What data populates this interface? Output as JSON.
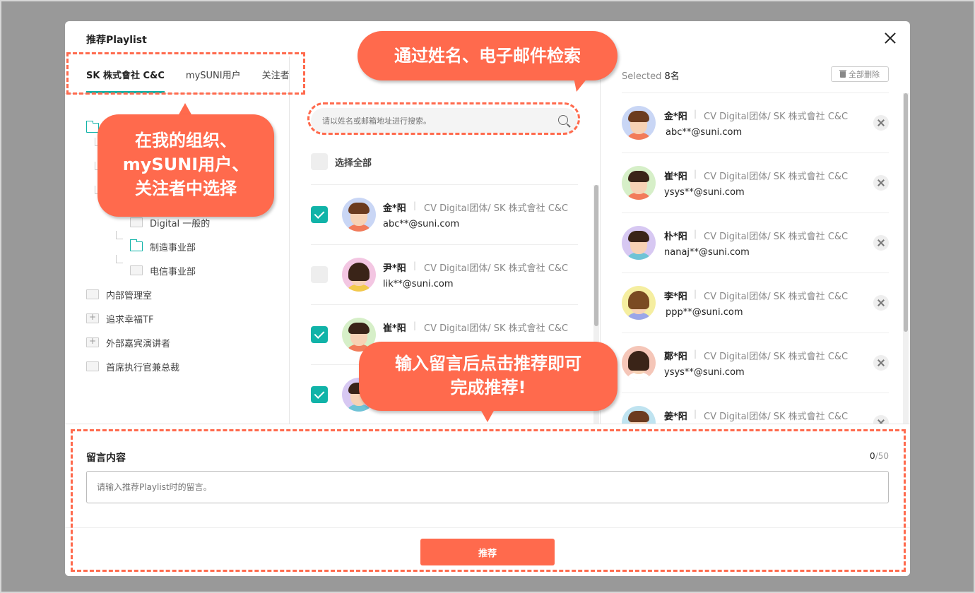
{
  "modal": {
    "title": "推荐Playlist",
    "close_icon": "close-icon"
  },
  "tabs": [
    {
      "label": "SK 株式會社 C&C",
      "active": true
    },
    {
      "label": "mySUNI用户",
      "active": false
    },
    {
      "label": "关注者",
      "active": false
    }
  ],
  "tree": {
    "items": [
      {
        "label": "Digital 一般的"
      },
      {
        "label": "制造事业部"
      },
      {
        "label": "电信事业部"
      },
      {
        "label": "内部管理室"
      },
      {
        "label": "追求幸福TF"
      },
      {
        "label": "外部嘉宾演讲者"
      },
      {
        "label": "首席执行官兼总裁"
      }
    ]
  },
  "search": {
    "placeholder": "请以姓名或邮箱地址进行搜索。"
  },
  "select_all": {
    "label": "选择全部"
  },
  "people": [
    {
      "name": "金*阳",
      "sep": "|",
      "org": "CV Digital团体/ SK 株式會社 C&C",
      "email": "abc**@suni.com",
      "checked": true
    },
    {
      "name": "尹*阳",
      "sep": "|",
      "org": "CV Digital团体/ SK 株式會社 C&C",
      "email": "lik**@suni.com",
      "checked": false
    },
    {
      "name": "崔*阳",
      "sep": "|",
      "org": "CV Digital团体/ SK 株式會社 C&C",
      "email": "",
      "checked": true
    },
    {
      "name": "",
      "sep": "",
      "org": "",
      "email": "",
      "checked": true
    }
  ],
  "selected": {
    "prefix": "Selected",
    "count": "8名",
    "delete_all": "全部删除",
    "items": [
      {
        "name": "金*阳",
        "sep": "|",
        "org": "CV Digital团体/ SK 株式會社 C&C",
        "email": "abc**@suni.com"
      },
      {
        "name": "崔*阳",
        "sep": "|",
        "org": "CV Digital团体/ SK 株式會社 C&C",
        "email": "ysys**@suni.com"
      },
      {
        "name": "朴*阳",
        "sep": "|",
        "org": "CV Digital团体/ SK 株式會社 C&C",
        "email": "nanaj**@suni.com"
      },
      {
        "name": "李*阳",
        "sep": "|",
        "org": "CV Digital团体/ SK 株式會社 C&C",
        "email": "ppp**@suni.com"
      },
      {
        "name": "鄭*阳",
        "sep": "|",
        "org": "CV Digital团体/ SK 株式會社 C&C",
        "email": "ysys**@suni.com"
      },
      {
        "name": "姜*阳",
        "sep": "|",
        "org": "CV Digital团体/ SK 株式會社 C&C",
        "email": ""
      }
    ]
  },
  "comment": {
    "label": "留言内容",
    "count_current": "0",
    "count_max": "/50",
    "placeholder": "请输入推荐Playlist时的留言。"
  },
  "recommend_button": "推荐",
  "annotations": {
    "search_tip": "通过姓名、电子邮件检索",
    "org_tip_line1": "在我的组织、",
    "org_tip_line2": "mySUNI用户、",
    "org_tip_line3": "关注者中选择",
    "comment_tip_line1": "输入留言后点击推荐即可",
    "comment_tip_line2": "完成推荐!"
  },
  "colors": {
    "accent": "#11b3a8",
    "annotation": "#ff6a4d",
    "button": "#ff6a4d"
  }
}
